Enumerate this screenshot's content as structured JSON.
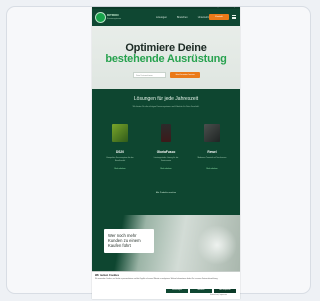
{
  "header": {
    "logo_text": "DITRON",
    "logo_sub": "Kassensysteme",
    "nav": [
      "Lösungen",
      "Branchen",
      "Unternehmen"
    ],
    "cta": "Kontakt",
    "top_links": [
      "Support",
      "Kontakt",
      "Login"
    ]
  },
  "hero": {
    "title_line1": "Optimiere Deine",
    "title_line2": "bestehende Ausrüstung",
    "input_placeholder": "Dein Unternehmen",
    "cta": "Jetzt beraten lassen"
  },
  "solutions": {
    "title": "Lösungen für jede Jahreszeit",
    "subtitle": "Wir bieten Dir die richtigen Kassensysteme und Zubehör für Dein Geschäft.",
    "products": [
      {
        "name": "DS20",
        "desc": "Kompaktes Kassensystem für den Einzelhandel",
        "link": "Mehr erfahren"
      },
      {
        "name": "GloriaFusco",
        "desc": "Leistungsstarke Lösung für die Gastronomie",
        "link": "Mehr erfahren"
      },
      {
        "name": "Rewel",
        "desc": "Modernes Terminal mit Touchscreen",
        "link": "Mehr erfahren"
      }
    ],
    "all_link": "Alle Produkte ansehen"
  },
  "photo": {
    "box_text": "Wer noch mehr Kunden zu einem Kaufen führt"
  },
  "cookie": {
    "title": "Wir nutzen Cookies",
    "text": "Wir verwenden Cookies, um Inhalte zu personalisieren und die Zugriffe auf unsere Website zu analysieren. Weitere Informationen findest Du in unserer Datenschutzerklärung.",
    "btn_settings": "Einstellungen",
    "btn_decline": "Ablehnen",
    "btn_accept": "Alle akzeptieren",
    "link": "Datenschutz | Impressum"
  }
}
